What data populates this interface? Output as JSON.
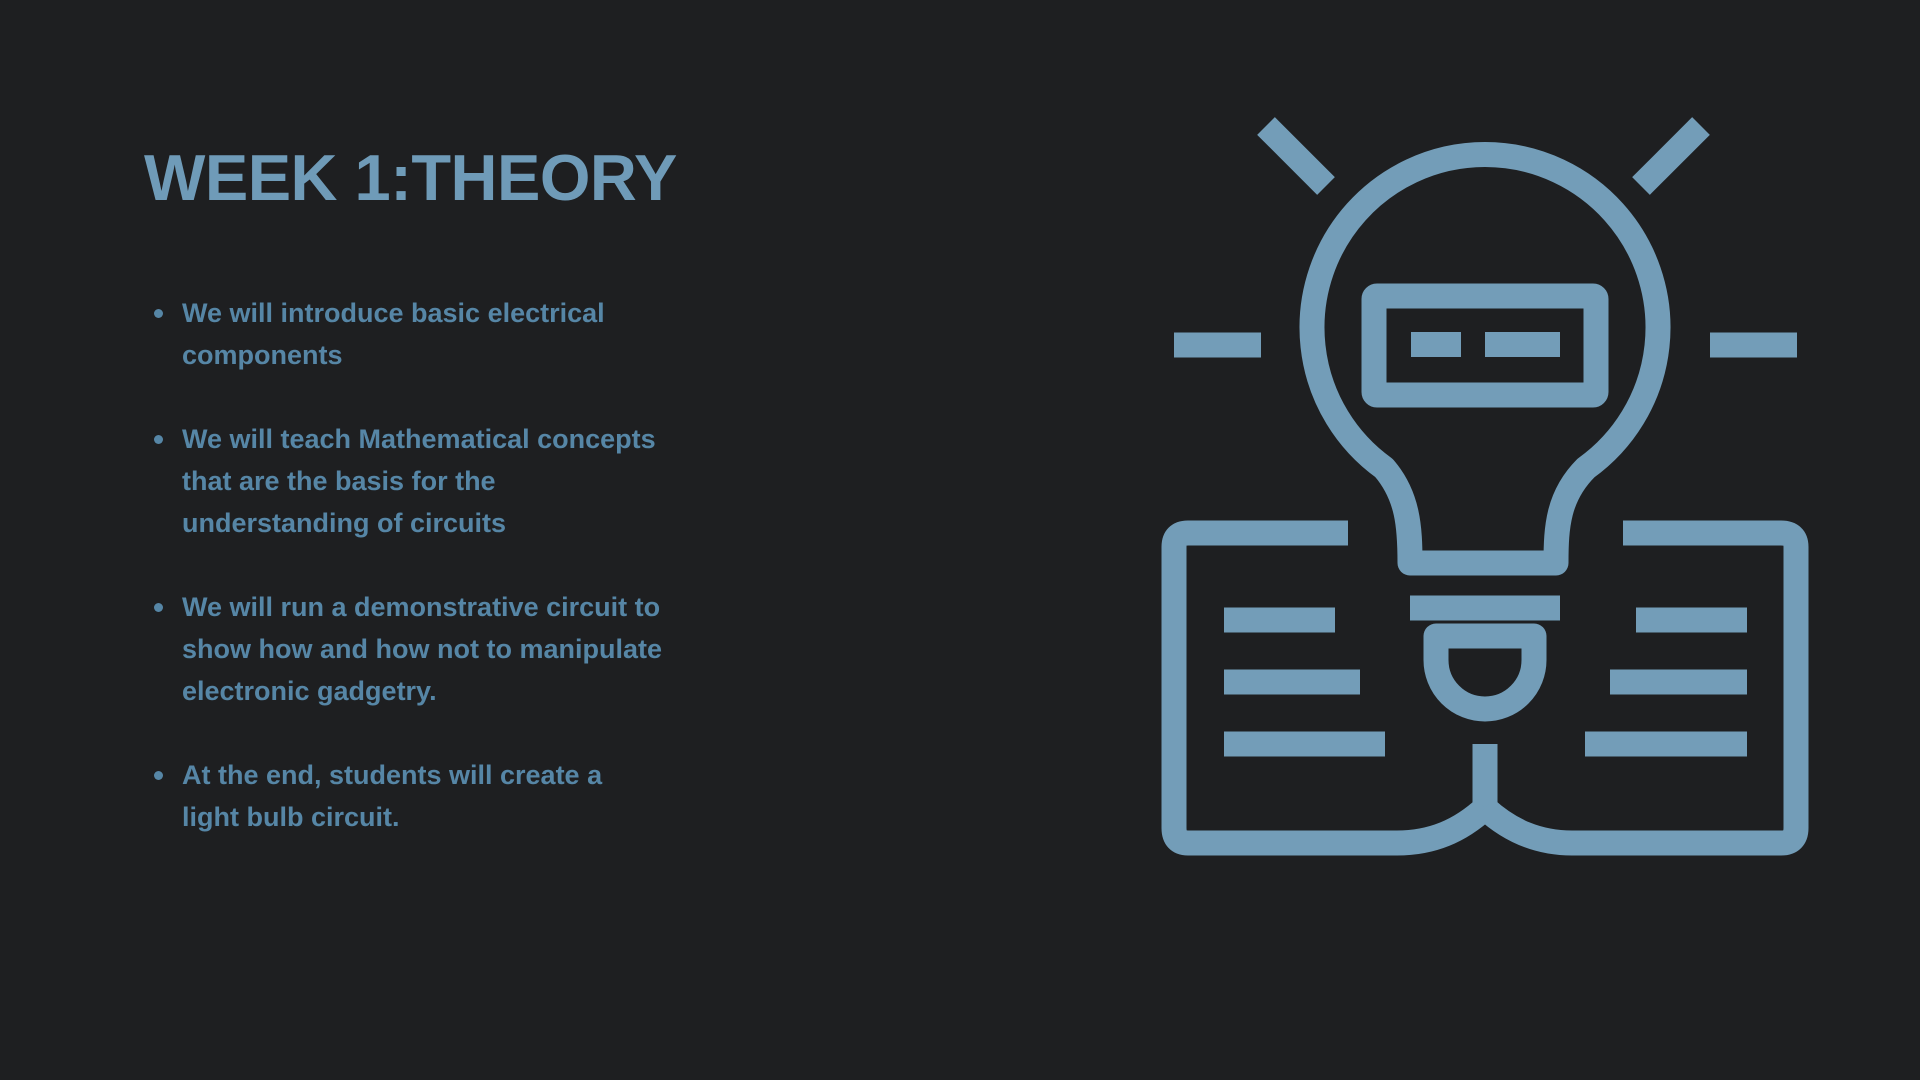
{
  "slide": {
    "title": "WEEK 1:THEORY",
    "bullets": [
      "We will introduce basic electrical components",
      "We will teach Mathematical concepts that are the basis for the understanding of circuits",
      "We will run a demonstrative circuit to show how and how not to manipulate electronic gadgetry.",
      "At the end, students will create a light bulb circuit."
    ],
    "illustration_icon": "lightbulb-open-book-icon",
    "colors": {
      "background": "#1e1f21",
      "title": "#6f9bb8",
      "body_text": "#5686a6",
      "icon": "#739db8"
    }
  }
}
